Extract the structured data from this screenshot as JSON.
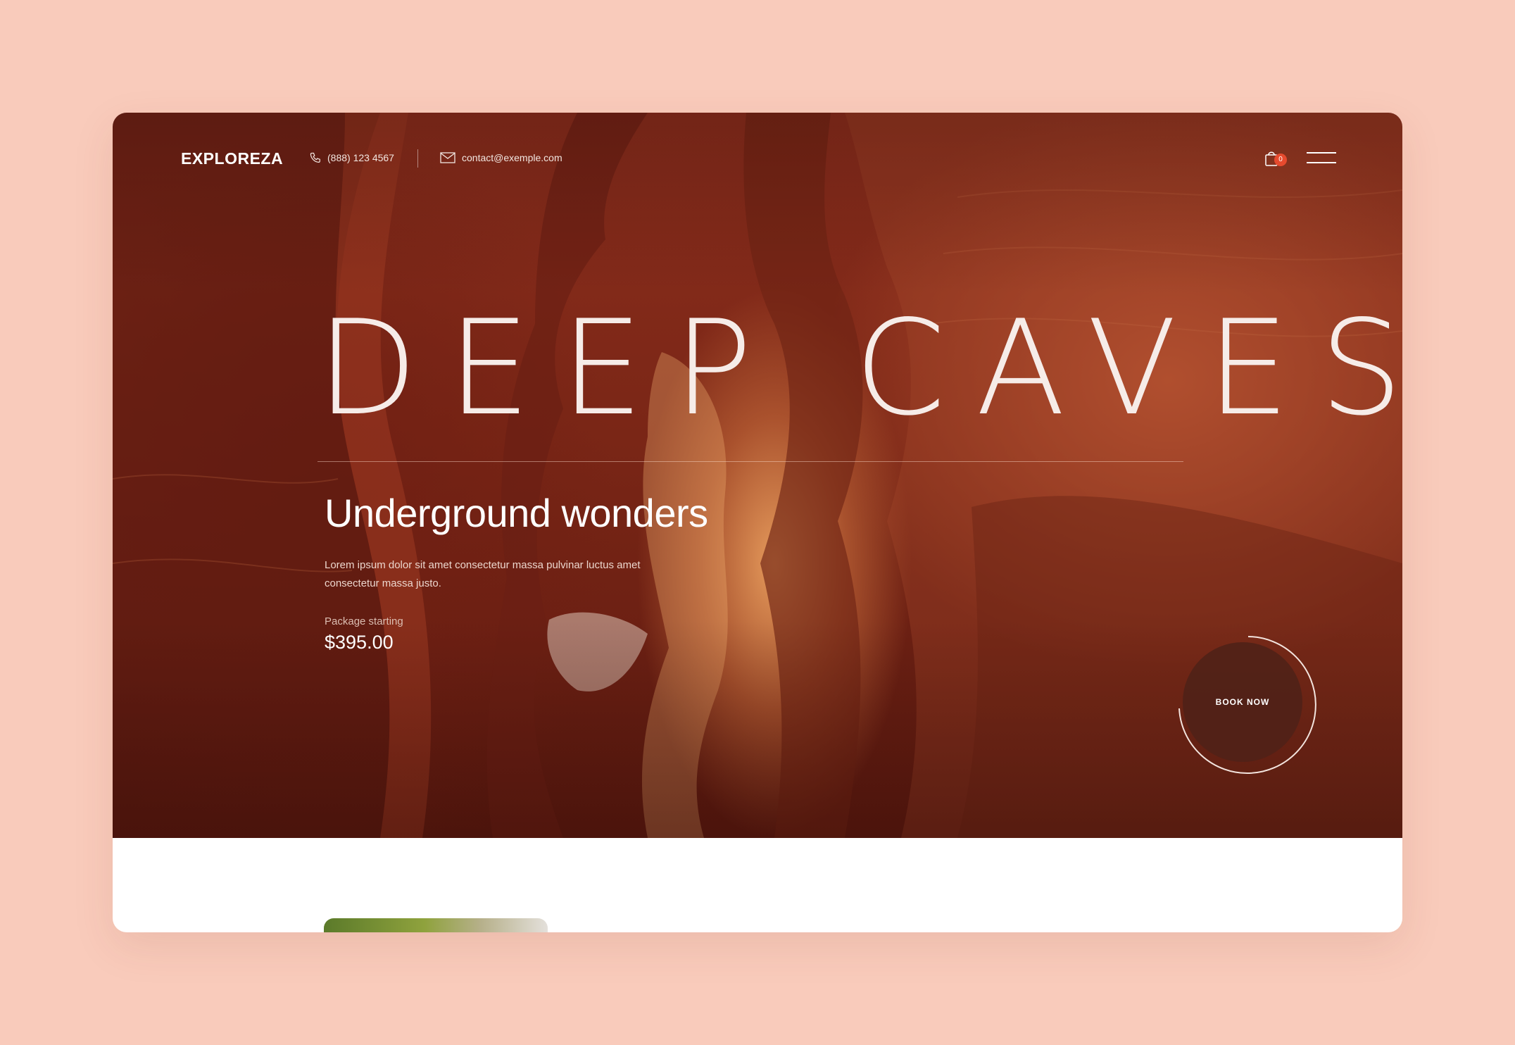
{
  "nav": {
    "logo": "EXPLOREZA",
    "phone": "(888) 123 4567",
    "email": "contact@exemple.com",
    "cart_count": "0",
    "icons": [
      "phone-icon",
      "mail-icon",
      "shopping-bag-icon",
      "hamburger-menu-icon"
    ]
  },
  "hero": {
    "title": "DEEP CAVES",
    "subtitle": "Underground wonders",
    "description": "Lorem ipsum dolor sit amet consectetur massa pulvinar luctus amet consectetur massa justo.",
    "package_label": "Package starting",
    "price": "$395.00",
    "cta": "BOOK NOW"
  },
  "colors": {
    "page_background": "#f9cbbb",
    "hero_rock": "#7a2616",
    "cart_badge": "#e64a2e",
    "cta_background": "#502218"
  }
}
